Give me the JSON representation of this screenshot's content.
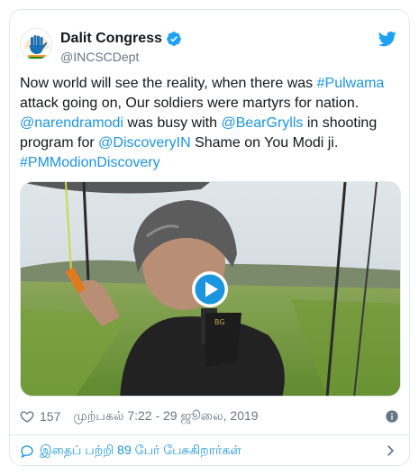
{
  "account": {
    "display_name": "Dalit Congress",
    "handle": "@INCSCDept"
  },
  "tweet": {
    "segments": [
      {
        "text": "Now world will see the reality, when there was ",
        "type": "text"
      },
      {
        "text": "#Pulwama",
        "type": "link"
      },
      {
        "text": " attack going on, Our soldiers were martyrs for nation. ",
        "type": "text"
      },
      {
        "text": "@narendramodi",
        "type": "link"
      },
      {
        "text": " was busy with ",
        "type": "text"
      },
      {
        "text": "@BearGrylls",
        "type": "link"
      },
      {
        "text": " in shooting program for ",
        "type": "text"
      },
      {
        "text": "@DiscoveryIN",
        "type": "link"
      },
      {
        "text": " Shame on You Modi ji. ",
        "type": "text"
      },
      {
        "text": "#PMModionDiscovery",
        "type": "link"
      }
    ]
  },
  "meta": {
    "likes": "157",
    "timestamp": "முற்பகல் 7:22 - 29 ஜூலை, 2019"
  },
  "footer": {
    "replies_text": "இதைப் பற்றி 89 பேர் பேசுகிறார்கள்"
  },
  "colors": {
    "link": "#1b95e0",
    "text": "#14171a",
    "muted": "#657786",
    "border": "#e1e8ed"
  },
  "icons": [
    "verified-icon",
    "twitter-bird-icon",
    "play-icon",
    "heart-icon",
    "info-icon",
    "reply-bubble-icon",
    "chevron-right-icon"
  ]
}
